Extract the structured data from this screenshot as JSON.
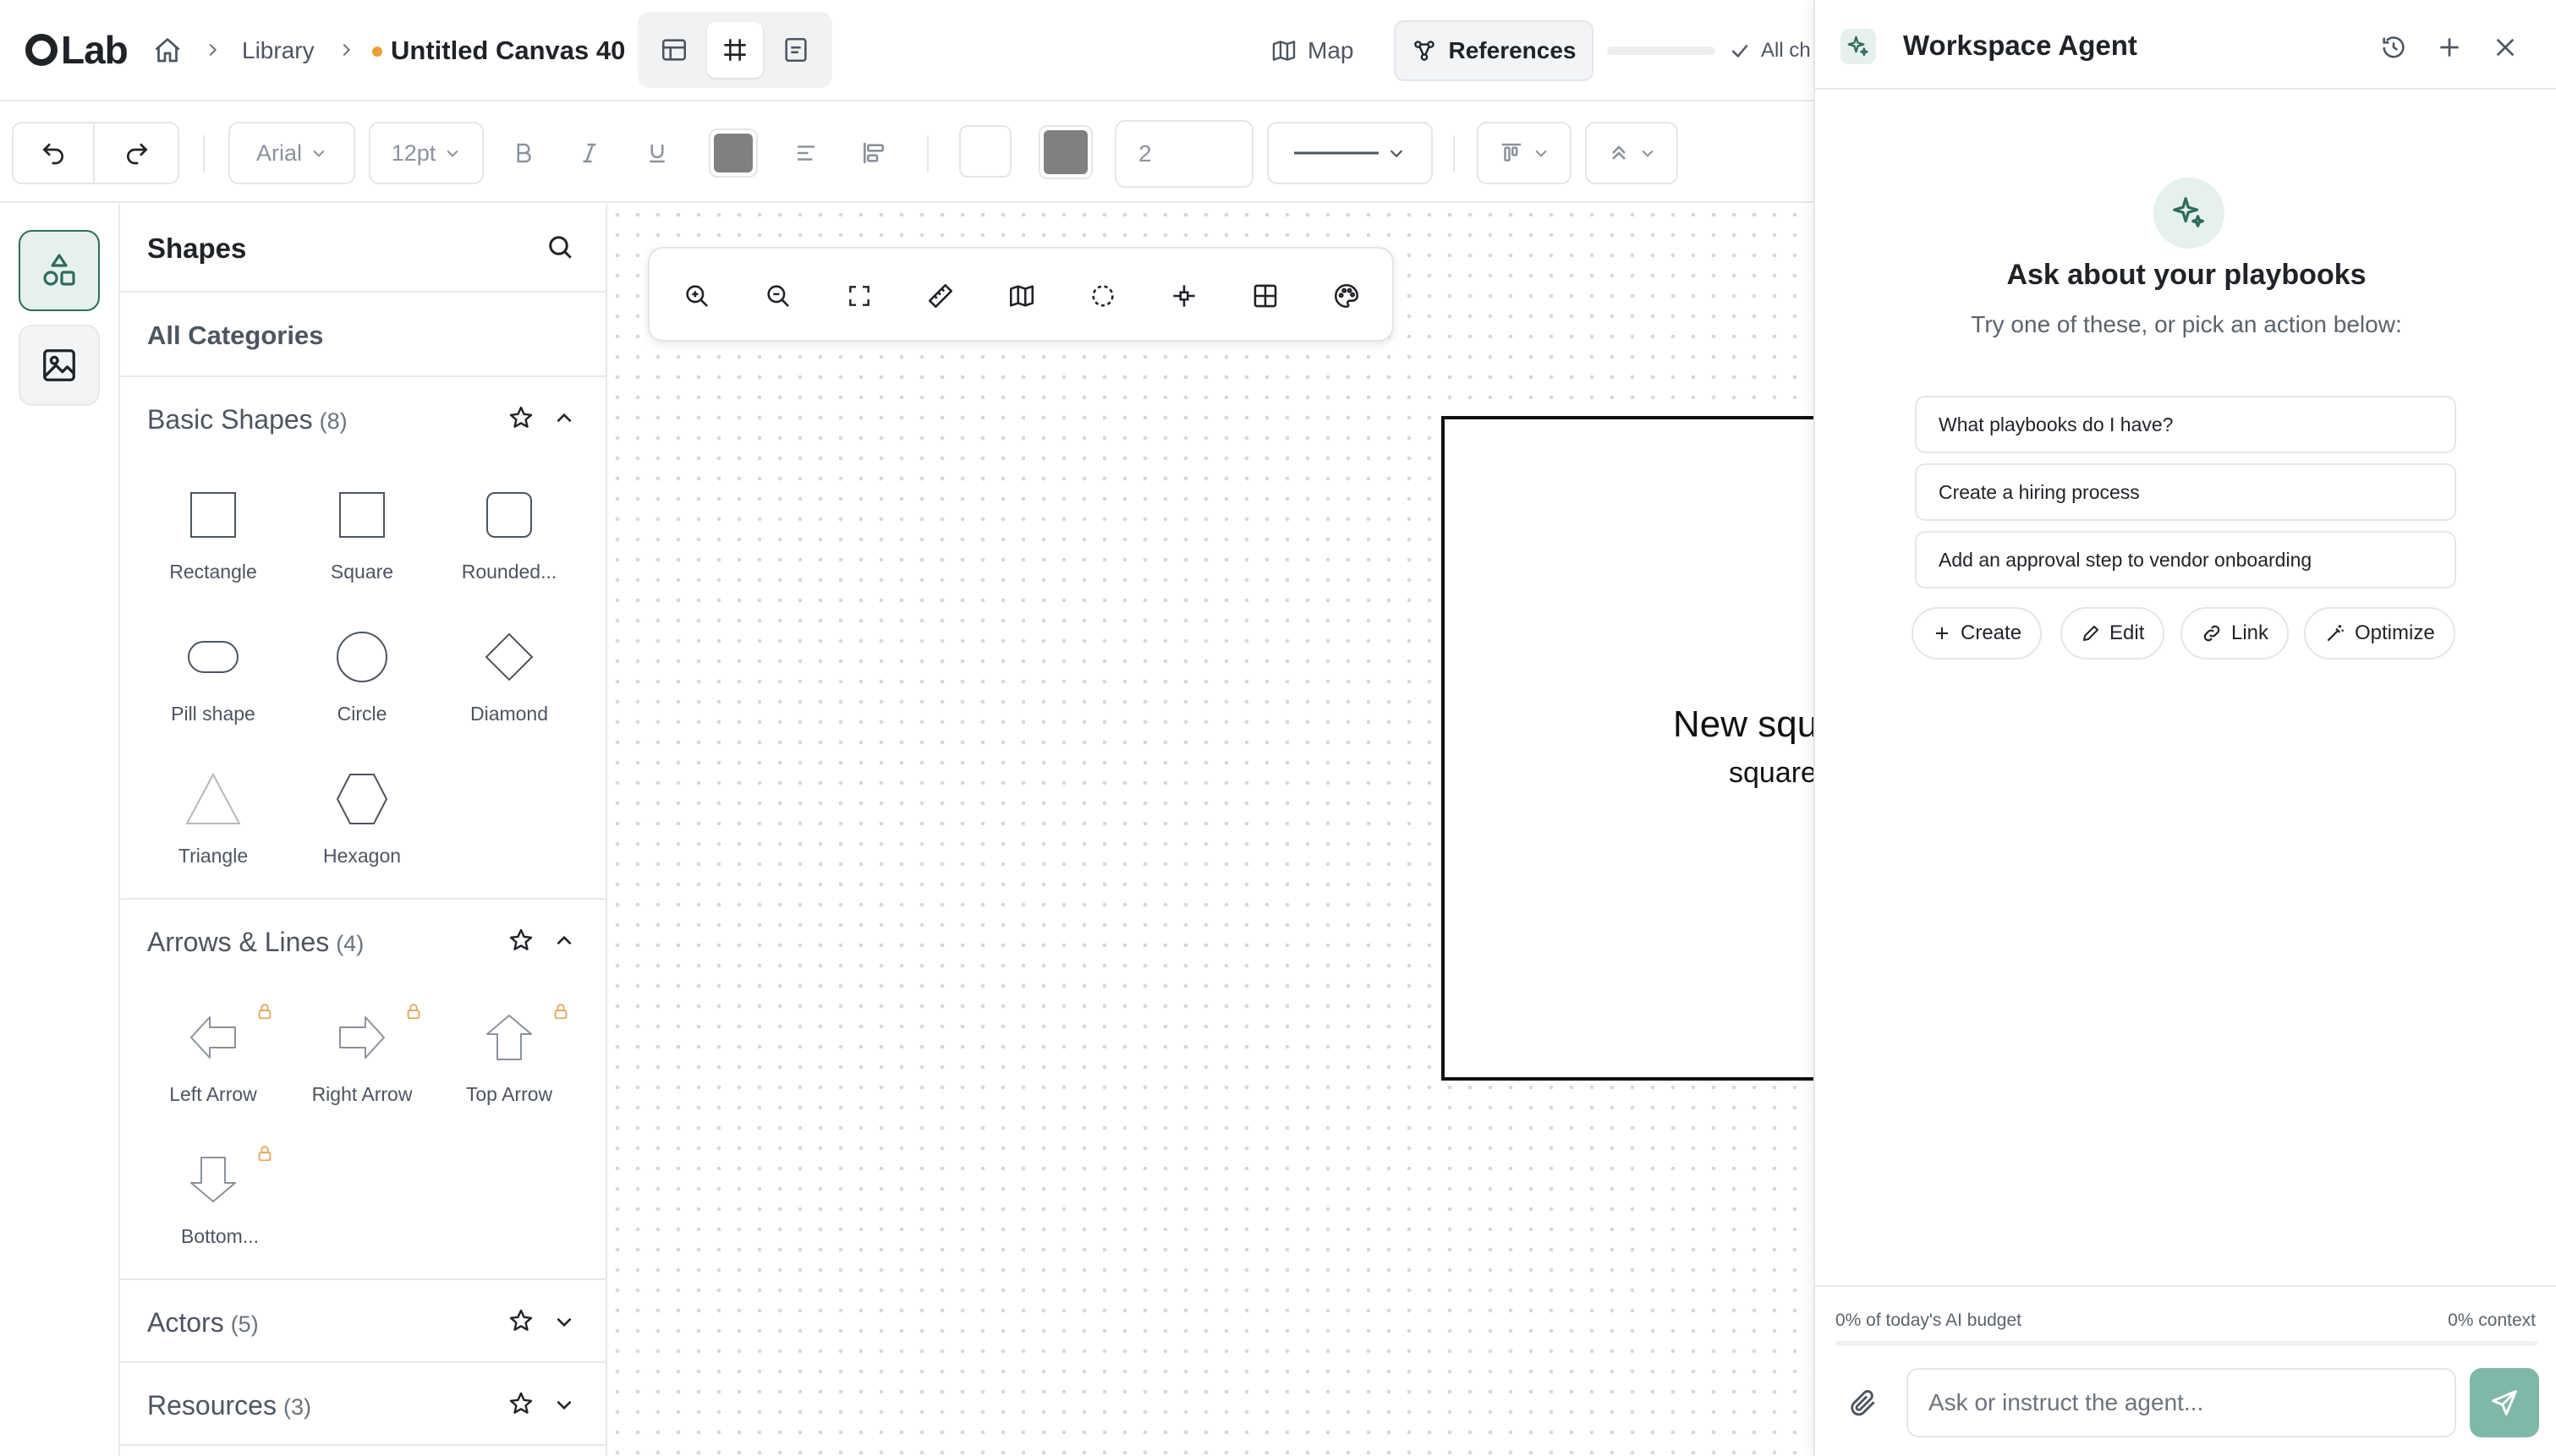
{
  "app": {
    "logo_text": "Lab"
  },
  "breadcrumb": {
    "library": "Library",
    "title": "Untitled Canvas 40"
  },
  "header": {
    "map_label": "Map",
    "references_label": "References",
    "save_status": "All ch"
  },
  "format": {
    "font": "Arial",
    "size": "12pt",
    "stroke_width": "2",
    "fill_color": "#808080",
    "stroke_color": "#808080"
  },
  "panel": {
    "title": "Shapes",
    "all_categories": "All Categories",
    "categories": [
      {
        "name": "Basic Shapes",
        "count": "(8)",
        "expanded": true,
        "items": [
          "Rectangle",
          "Square",
          "Rounded...",
          "Pill shape",
          "Circle",
          "Diamond",
          "Triangle",
          "Hexagon"
        ]
      },
      {
        "name": "Arrows & Lines",
        "count": "(4)",
        "expanded": true,
        "items": [
          "Left Arrow",
          "Right Arrow",
          "Top Arrow",
          "Bottom..."
        ]
      },
      {
        "name": "Actors",
        "count": "(5)",
        "expanded": false
      },
      {
        "name": "Resources",
        "count": "(3)",
        "expanded": false
      }
    ]
  },
  "canvas": {
    "shape_title": "New squ",
    "shape_subtitle": "square"
  },
  "agent": {
    "title": "Workspace Agent",
    "heading": "Ask about your playbooks",
    "subheading": "Try one of these, or pick an action below:",
    "suggestions": [
      "What playbooks do I have?",
      "Create a hiring process",
      "Add an approval step to vendor onboarding"
    ],
    "actions": [
      "Create",
      "Edit",
      "Link",
      "Optimize"
    ],
    "budget": "0% of today's AI budget",
    "context": "0% context",
    "input_placeholder": "Ask or instruct the agent..."
  },
  "colors": {
    "accent": "#2f6b5e",
    "accent_light": "#e6f1ee",
    "send": "#7fb8a8",
    "unsaved_dot": "#e8a13a",
    "lock": "#e0a75a"
  }
}
